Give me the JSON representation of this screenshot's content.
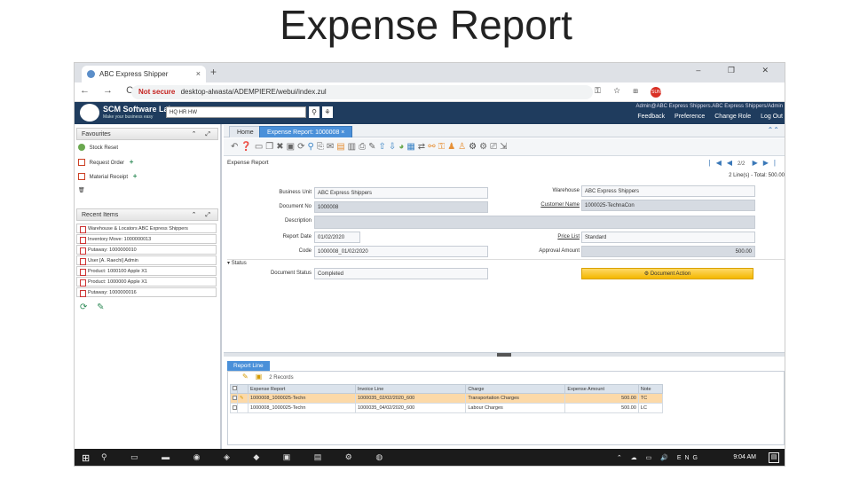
{
  "slide": {
    "title": "Expense Report"
  },
  "browser": {
    "tab_title": "ABC Express Shipper",
    "close": "×",
    "new_tab": "+",
    "window_controls": "– ❐ ✕",
    "nav": "← → C",
    "security": "Not secure",
    "url": "desktop-alwasta/ADEMPIERE/webui/index.zul",
    "extensions": "⚿ ☆ ⊞"
  },
  "app": {
    "logo_title": "SCM Software Lab",
    "logo_tagline": "Make your business easy",
    "search_value": "HQ HR HW",
    "search_icon": "search-icon",
    "user_line": "Admin@ABC Express Shippers.ABC Express Shippers/Admin",
    "menu": {
      "feedback": "Feedback",
      "preference": "Preference",
      "change_role": "Change Role",
      "logout": "Log Out"
    }
  },
  "sidebar": {
    "favourites_title": "Favourites",
    "favourites": [
      {
        "label": "Stock Reset",
        "color": "#6aa84f"
      },
      {
        "label": "Request Order",
        "color": "#cc4125"
      },
      {
        "label": "Material Receipt",
        "color": "#cc4125"
      }
    ],
    "recent_title": "Recent Items",
    "recent": [
      "Warehouse & Locators ABC Express Shippers",
      "Inventory Move: 1000000013",
      "Putaway: 1000000010",
      "User [A. Raechi] Admin",
      "Product: 1000100 Apple X1",
      "Product: 1000000 Apple X1",
      "Putaway: 1000000016"
    ]
  },
  "main": {
    "tabs": [
      "Home",
      "Expense Report: 1000008"
    ],
    "breadcrumb": "Expense Report",
    "pager_count": "2/2",
    "lines_info": "2 Line(s) - Total: 500.00",
    "fields": {
      "business_unit_label": "Business Unit",
      "business_unit": "ABC Express Shippers",
      "document_no_label": "Document No",
      "document_no": "1000008",
      "description_label": "Description",
      "description": "",
      "report_date_label": "Report Date",
      "report_date": "01/02/2020",
      "code_label": "Code",
      "code": "1000008_01/02/2020",
      "warehouse_label": "Warehouse",
      "warehouse": "ABC Express Shippers",
      "customer_name_label": "Customer Name",
      "customer_name": "1000025-TechnaCon",
      "price_list_label": "Price List",
      "price_list": "Standard",
      "approval_amount_label": "Approval Amount",
      "approval_amount": "500.00"
    },
    "status_section": "Status",
    "document_status_label": "Document Status",
    "document_status": "Completed",
    "document_action": "Document Action"
  },
  "report_line": {
    "tab": "Report Line",
    "records": "2 Records",
    "columns": [
      "Expense Report",
      "Invoice Line",
      "Charge",
      "Expense Amount",
      "Note"
    ],
    "rows": [
      [
        "1000008_1000025-Techn",
        "1000035_02/02/2020_600",
        "Transportation Charges",
        "500.00",
        "TC"
      ],
      [
        "1000008_1000025-Techn",
        "1000035_04/02/2020_600",
        "Labour Charges",
        "500.00",
        "LC"
      ]
    ]
  },
  "taskbar": {
    "start": "⊞",
    "apps": "⚲ ▭ ▬ ◉ ◈ ◆ ▣ ▤ ⚙ ◍",
    "tray": "⌃ ☁ ▭ 🔊 ENG",
    "time": "9:04 AM",
    "notifications": "▤"
  },
  "colors": {
    "header_bg": "#1f3c5e",
    "active_tab": "#4a90d9",
    "doc_action": "#f3b700",
    "selected_row": "#fcd9a8"
  }
}
